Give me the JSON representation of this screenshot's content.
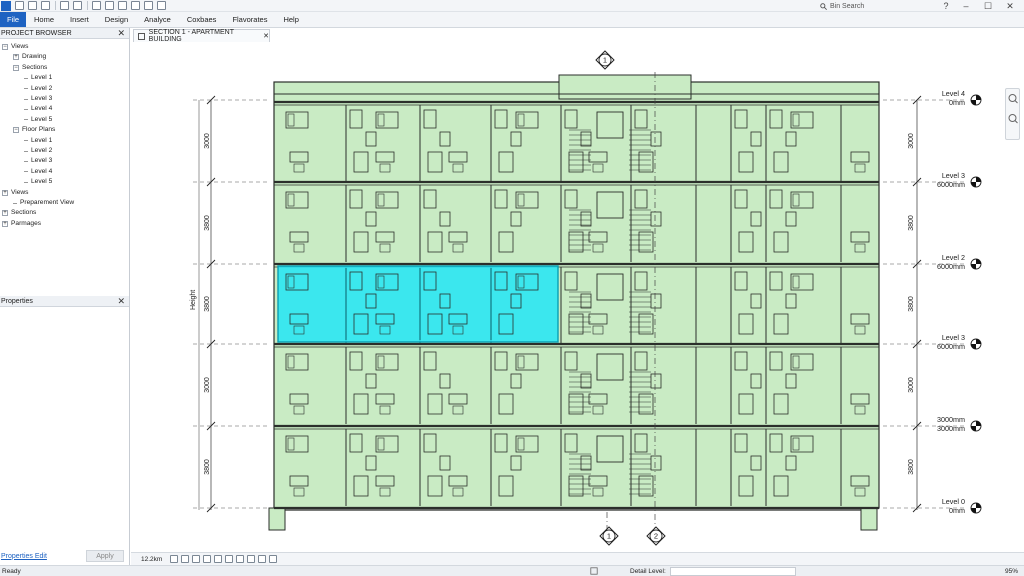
{
  "app": {
    "search_placeholder": "Bin Search",
    "window_controls": [
      "?",
      "–",
      "☐",
      "✕"
    ]
  },
  "ribbon": {
    "tabs": [
      "File",
      "Home",
      "Insert",
      "Design",
      "Analyce",
      "Coxbaes",
      "Flavorates",
      "Help"
    ]
  },
  "project_browser": {
    "title": "PROJECT BROWSER",
    "items": [
      {
        "label": "Views",
        "level": 0,
        "toggle": "−"
      },
      {
        "label": "Drawing",
        "level": 1,
        "toggle": "+"
      },
      {
        "label": "Sections",
        "level": 1,
        "toggle": "−"
      },
      {
        "label": "Level 1",
        "level": 2
      },
      {
        "label": "Level 2",
        "level": 2
      },
      {
        "label": "Level 3",
        "level": 2
      },
      {
        "label": "Level 4",
        "level": 2
      },
      {
        "label": "Level 5",
        "level": 2
      },
      {
        "label": "Floor Plans",
        "level": 1,
        "toggle": "−"
      },
      {
        "label": "Level 1",
        "level": 2
      },
      {
        "label": "Level 2",
        "level": 2
      },
      {
        "label": "Level 3",
        "level": 2
      },
      {
        "label": "Level 4",
        "level": 2
      },
      {
        "label": "Level 5",
        "level": 2
      },
      {
        "label": "Views",
        "level": 0,
        "toggle": "+"
      },
      {
        "label": "Preparement View",
        "level": 1
      },
      {
        "label": "Sections",
        "level": 0,
        "toggle": "+"
      },
      {
        "label": "Parmages",
        "level": 0,
        "toggle": "+"
      }
    ]
  },
  "properties": {
    "title": "Properties",
    "link": "Properties Edit",
    "apply": "Apply"
  },
  "view_tab": {
    "title": "SECTION 1 - APARTMENT BUILDING"
  },
  "drawing": {
    "height_label": "Height",
    "dimensions": [
      "3000",
      "3800",
      "3800",
      "3000",
      "3800"
    ],
    "levels": [
      {
        "name": "Level 4",
        "value": "0mm"
      },
      {
        "name": "Level 3",
        "value": "6000mm"
      },
      {
        "name": "Level 2",
        "value": "6000mm"
      },
      {
        "name": "Level 3",
        "value": "6000mm"
      },
      {
        "name": "3000mm",
        "value": "3000mm"
      },
      {
        "name": "Level 0",
        "value": "0mm"
      }
    ],
    "grid_markers": {
      "top": "1",
      "bottom_left": "1",
      "bottom_right": "2"
    },
    "highlight_color": "#22e6f6",
    "fill_color": "#c9ebc4",
    "line_color": "#2b2f2b"
  },
  "view_control": {
    "scale": "12.2km"
  },
  "status": {
    "ready": "Ready",
    "detail_level_label": "Detail Level:",
    "zoom": "95%"
  }
}
